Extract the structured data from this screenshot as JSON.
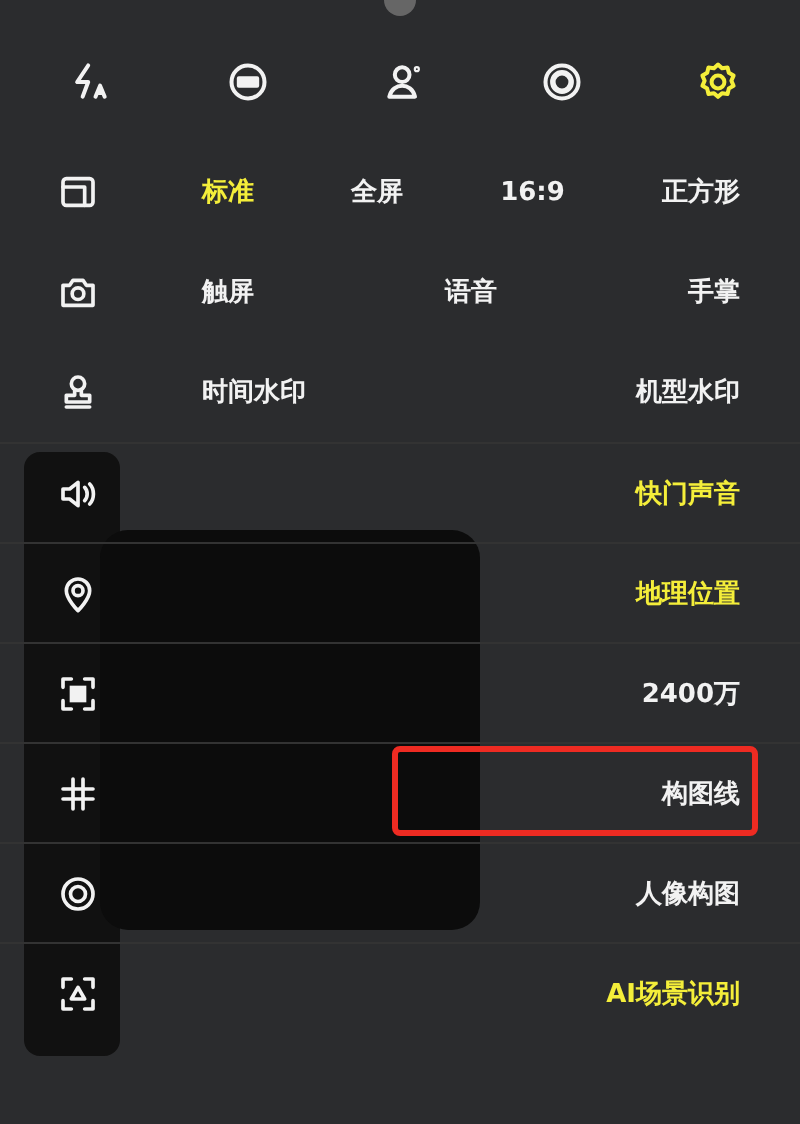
{
  "top_bar": [
    {
      "kind": "flash",
      "selected": false
    },
    {
      "kind": "hdr",
      "selected": false
    },
    {
      "kind": "portrait",
      "selected": false
    },
    {
      "kind": "live",
      "selected": false
    },
    {
      "kind": "settings",
      "selected": true
    }
  ],
  "settings": [
    {
      "kind": "frame",
      "options": [
        {
          "label": "标准",
          "selected": true
        },
        {
          "label": "全屏",
          "selected": false
        },
        {
          "label": "16:9",
          "selected": false
        },
        {
          "label": "正方形",
          "selected": false
        }
      ]
    },
    {
      "kind": "camera",
      "options": [
        {
          "label": "触屏",
          "selected": false
        },
        {
          "label": "语音",
          "selected": false
        },
        {
          "label": "手掌",
          "selected": false
        }
      ]
    },
    {
      "kind": "stamp",
      "options": [
        {
          "label": "时间水印",
          "selected": false
        },
        {
          "label": "机型水印",
          "selected": false
        }
      ]
    },
    {
      "kind": "speaker",
      "label": "快门声音",
      "on": true,
      "highlighted": false
    },
    {
      "kind": "pin",
      "label": "地理位置",
      "on": true,
      "highlighted": false
    },
    {
      "kind": "focus",
      "label": "2400万",
      "on": false,
      "highlighted": false
    },
    {
      "kind": "grid",
      "label": "构图线",
      "on": false,
      "highlighted": true
    },
    {
      "kind": "target",
      "label": "人像构图",
      "on": false,
      "highlighted": false
    },
    {
      "kind": "scan",
      "label": "AI场景识别",
      "on": true,
      "highlighted": false
    }
  ]
}
